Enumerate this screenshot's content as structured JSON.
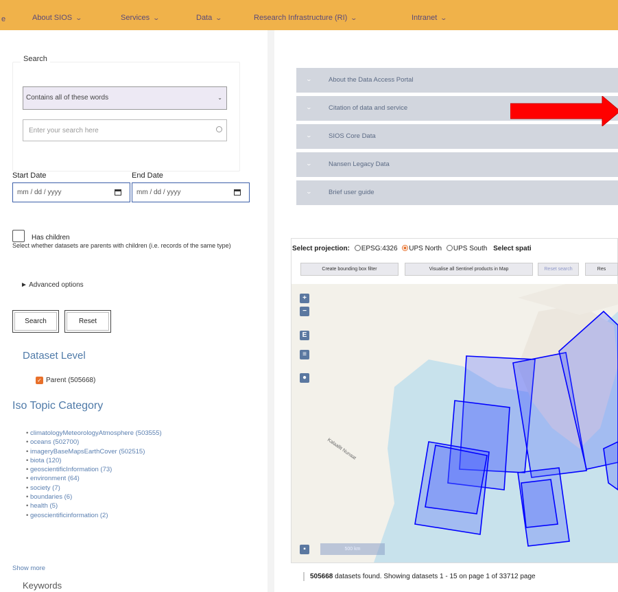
{
  "nav": {
    "edge_label": "e",
    "items": [
      "About SIOS",
      "Services",
      "Data",
      "Research Infrastructure (RI)",
      "Intranet"
    ]
  },
  "search": {
    "legend": "Search",
    "mode": "Contains all of these words",
    "placeholder": "Enter your search here",
    "start_date_label": "Start Date",
    "end_date_label": "End Date",
    "date_placeholder": "mm / dd / yyyy",
    "has_children_label": "Has children",
    "has_children_desc": "Select whether datasets are parents with children (i.e. records of the same type)",
    "advanced": "► Advanced options",
    "search_button": "Search",
    "reset_button": "Reset"
  },
  "facets": {
    "dataset_level_title": "Dataset Level",
    "parent_label": "Parent (505668)",
    "iso_title": "Iso Topic Category",
    "topics": [
      "climatologyMeteorologyAtmosphere (503555)",
      "oceans (502700)",
      "imageryBaseMapsEarthCover (502515)",
      "biota (120)",
      "geoscientificInformation (73)",
      "environment (64)",
      "society (7)",
      "boundaries (6)",
      "health (5)",
      "geoscientificinformation (2)"
    ],
    "show_more": "Show more",
    "keywords_title": "Keywords"
  },
  "accordion": [
    "About the Data Access Portal",
    "Citation of data and service",
    "SIOS Core Data",
    "Nansen Legacy Data",
    "Brief user guide"
  ],
  "map": {
    "select_projection": "Select projection:",
    "projections": [
      "EPSG:4326",
      "UPS North",
      "UPS South"
    ],
    "selected_projection": "UPS North",
    "select_spatial": "Select spati",
    "buttons": [
      "Create bounding box filter",
      "Visualise all Sentinel products in Map",
      "Reset search",
      "Res"
    ],
    "controls": [
      "+",
      "−",
      "E",
      "≡",
      "●"
    ],
    "scale_label": "500 km",
    "place_label": "Kalaallit Nunaat"
  },
  "results": {
    "count": "505668",
    "text": "datasets found. Showing datasets 1 - 15 on page 1 of 33712 page"
  },
  "colors": {
    "nav_bg": "#f0b24a",
    "accent_orange": "#e8702a",
    "link_blue": "#5a7fb0",
    "footprint_blue": "#0000ff",
    "arrow_red": "#ff0000"
  }
}
